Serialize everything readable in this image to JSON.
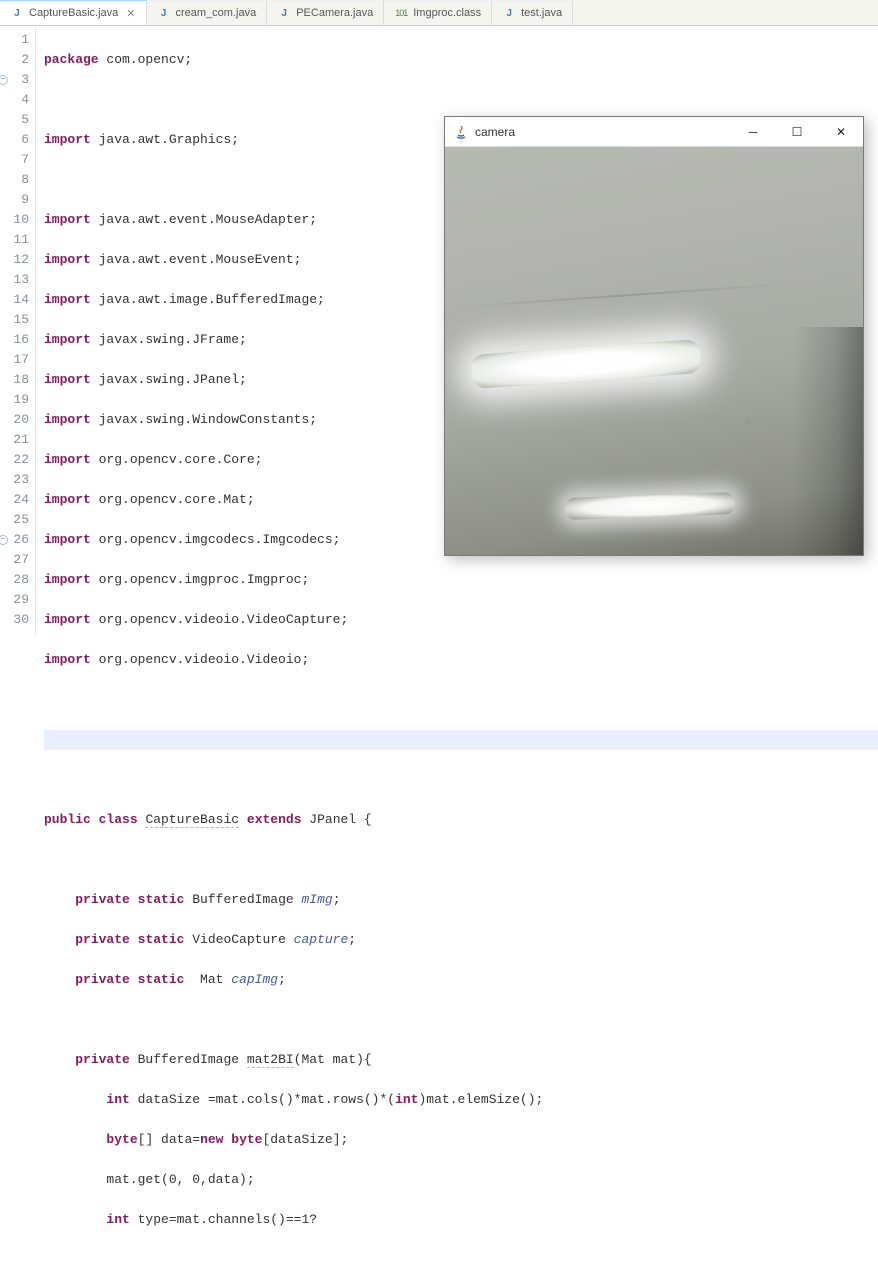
{
  "tabs": [
    {
      "label": "CaptureBasic.java",
      "icon": "J",
      "active": true,
      "closeable": true
    },
    {
      "label": "cream_com.java",
      "icon": "J",
      "active": false
    },
    {
      "label": "PECamera.java",
      "icon": "J",
      "active": false
    },
    {
      "label": "Imgproc.class",
      "icon": "101",
      "active": false
    },
    {
      "label": "test.java",
      "icon": "J",
      "active": false
    }
  ],
  "camera_window": {
    "title": "camera"
  },
  "code_lines": {
    "l1": {
      "kw": "package",
      "rest": " com.opencv;"
    },
    "l2": {
      "rest": ""
    },
    "l3": {
      "kw": "import",
      "rest": " java.awt.Graphics;"
    },
    "l4": {
      "rest": ""
    },
    "l5": {
      "kw": "import",
      "rest": " java.awt.event.MouseAdapter;"
    },
    "l6": {
      "kw": "import",
      "rest": " java.awt.event.MouseEvent;"
    },
    "l7": {
      "kw": "import",
      "rest": " java.awt.image.BufferedImage;"
    },
    "l8": {
      "kw": "import",
      "rest": " javax.swing.JFrame;"
    },
    "l9": {
      "kw": "import",
      "rest": " javax.swing.JPanel;"
    },
    "l10": {
      "kw": "import",
      "rest": " javax.swing.WindowConstants;"
    },
    "l11": {
      "kw": "import",
      "rest": " org.opencv.core.Core;"
    },
    "l12": {
      "kw": "import",
      "rest": " org.opencv.core.Mat;"
    },
    "l13": {
      "kw": "import",
      "rest": " org.opencv.imgcodecs.Imgcodecs;"
    },
    "l14": {
      "kw": "import",
      "rest": " org.opencv.imgproc.Imgproc;"
    },
    "l15": {
      "kw": "import",
      "rest": " org.opencv.videoio.VideoCapture;"
    },
    "l16": {
      "kw": "import",
      "rest": " org.opencv.videoio.Videoio;"
    },
    "l17": {
      "rest": ""
    },
    "l18": {
      "rest": ""
    },
    "l19": {
      "rest": ""
    },
    "l20": {
      "p1": "public",
      "p2": "class",
      "cls": "CaptureBasic",
      "p3": "extends",
      "p4": " JPanel {"
    },
    "l21": {
      "rest": ""
    },
    "l22": {
      "indent": "    ",
      "p1": "private",
      "p2": "static",
      "type": " BufferedImage ",
      "field": "mImg",
      "tail": ";"
    },
    "l23": {
      "indent": "    ",
      "p1": "private",
      "p2": "static",
      "type": " VideoCapture ",
      "field": "capture",
      "tail": ";"
    },
    "l24": {
      "indent": "    ",
      "p1": "private",
      "p2": "static",
      "type": "  Mat ",
      "field": "capImg",
      "tail": ";"
    },
    "l25": {
      "rest": ""
    },
    "l26": {
      "indent": "    ",
      "p1": "private",
      "type": " BufferedImage ",
      "method": "mat2BI",
      "tail": "(Mat mat){"
    },
    "l27": {
      "indent": "        ",
      "p1": "int",
      "var": " dataSize ",
      "tail": "=mat.cols()*mat.rows()*(",
      "cast": "int",
      "tail2": ")mat.elemSize();"
    },
    "l28": {
      "indent": "        ",
      "p1": "byte",
      "arr": "[] data=",
      "p2": "new",
      "p3": " byte",
      "tail": "[dataSize];"
    },
    "l29": {
      "indent": "        ",
      "tail": "mat.get(0, 0,data);"
    },
    "l30": {
      "indent": "        ",
      "p1": "int",
      "tail": " type=mat.channels()==1?"
    }
  },
  "line_numbers": [
    "1",
    "2",
    "3",
    "4",
    "5",
    "6",
    "7",
    "8",
    "9",
    "10",
    "11",
    "12",
    "13",
    "14",
    "15",
    "16",
    "17",
    "18",
    "19",
    "20",
    "21",
    "22",
    "23",
    "24",
    "25",
    "26",
    "27",
    "28",
    "29",
    "30"
  ],
  "fold_lines": [
    "3",
    "26"
  ],
  "highlighted_line": "18"
}
